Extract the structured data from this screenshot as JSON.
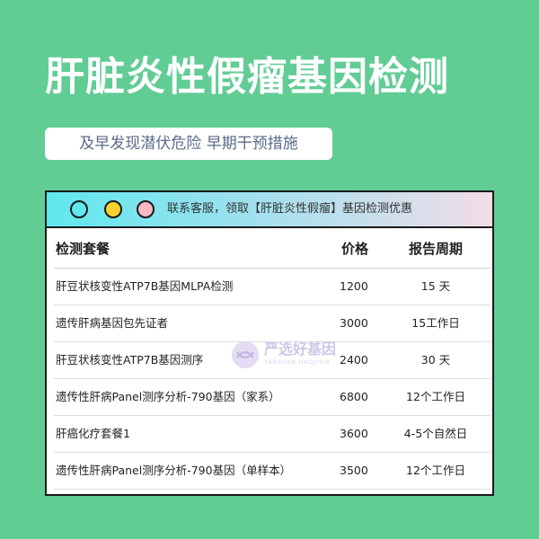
{
  "title": "肝脏炎性假瘤基因检测",
  "subtitle": "及早发现潜伏危险 早期干预措施",
  "window": {
    "bar_text": "联系客服，领取【肝脏炎性假瘤】基因检测优惠"
  },
  "table": {
    "headers": [
      "检测套餐",
      "价格",
      "报告周期"
    ],
    "rows": [
      {
        "name": "肝豆状核变性ATP7B基因MLPA检测",
        "price": "1200",
        "period": "15 天"
      },
      {
        "name": "遗传肝病基因包先证者",
        "price": "3000",
        "period": "15工作日"
      },
      {
        "name": "肝豆状核变性ATP7B基因测序",
        "price": "2400",
        "period": "30 天"
      },
      {
        "name": "遗传性肝病Panel测序分析-790基因（家系）",
        "price": "6800",
        "period": "12个工作日"
      },
      {
        "name": "肝癌化疗套餐1",
        "price": "3600",
        "period": "4-5个自然日"
      },
      {
        "name": "遗传性肝病Panel测序分析-790基因（单样本）",
        "price": "3500",
        "period": "12个工作日"
      }
    ]
  },
  "watermark": {
    "text": "严选好基因",
    "sub": "YANXUAN HAOJIYIN"
  },
  "colors": {
    "background": "#62cc95",
    "dot1": "#5fe8ee",
    "dot2": "#f7d12e",
    "dot3": "#f7b9c4"
  }
}
